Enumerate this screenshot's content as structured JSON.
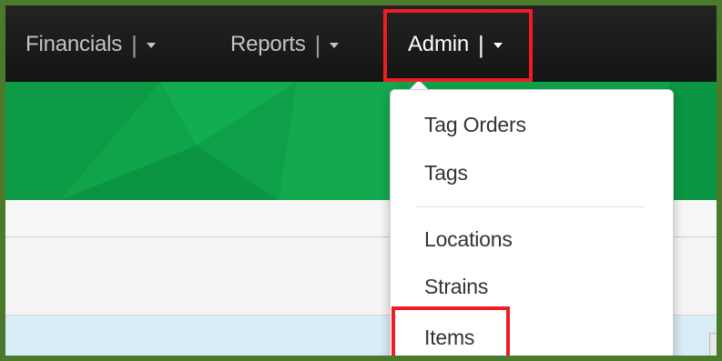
{
  "navbar": {
    "items": [
      {
        "label": "Financials",
        "separator": "|"
      },
      {
        "label": "Reports",
        "separator": "|"
      },
      {
        "label": "Admin",
        "separator": "|"
      }
    ]
  },
  "admin_menu": {
    "groups": [
      [
        "Tag Orders",
        "Tags"
      ],
      [
        "Locations",
        "Strains",
        "Items"
      ]
    ]
  },
  "colors": {
    "frame_border": "#4c7a2c",
    "navbar_bg": "#1a1a1a",
    "banner_green": "#0fa34a",
    "highlight_red": "#ee1c25",
    "info_band": "#d9edf7"
  },
  "icons": {
    "dropdown_caret": "caret-down-icon",
    "menu_pointer": "menu-arrow-icon"
  }
}
